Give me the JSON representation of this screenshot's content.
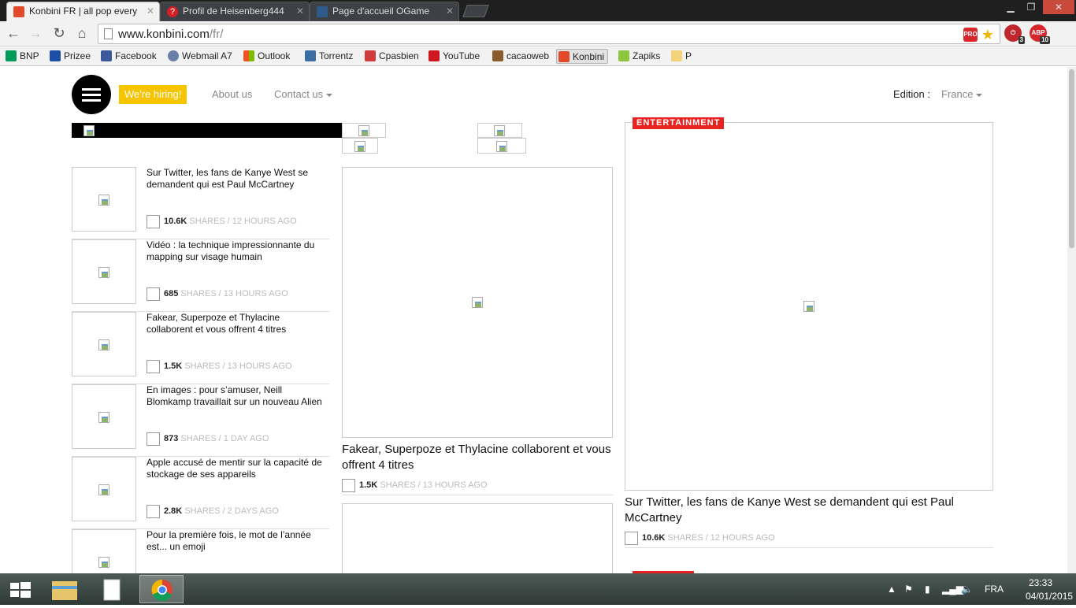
{
  "browser": {
    "tabs": [
      {
        "label": "Konbini FR | all pop every",
        "active": true
      },
      {
        "label": "Profil de Heisenberg444",
        "active": false
      },
      {
        "label": "Page d'accueil OGame",
        "active": false
      }
    ],
    "url_host": "www.konbini.com",
    "url_path": "/fr/",
    "omnibox_pro_badge": "PRO",
    "extensions": [
      {
        "name": "ublock-icon",
        "count": "3"
      },
      {
        "name": "abp-icon",
        "label": "ABP",
        "count": "10"
      }
    ],
    "bookmarks": [
      {
        "label": "BNP",
        "icon": "bnp-icon"
      },
      {
        "label": "Prizee",
        "icon": "prizee-icon"
      },
      {
        "label": "Facebook",
        "icon": "facebook-icon"
      },
      {
        "label": "Webmail A7",
        "icon": "webmail-icon"
      },
      {
        "label": "Outlook",
        "icon": "outlook-icon"
      },
      {
        "label": "Torrentz",
        "icon": "torrentz-icon"
      },
      {
        "label": "Cpasbien",
        "icon": "cpasbien-icon"
      },
      {
        "label": "YouTube",
        "icon": "youtube-icon"
      },
      {
        "label": "cacaoweb",
        "icon": "cacaoweb-icon"
      },
      {
        "label": "Konbini",
        "icon": "konbini-icon"
      },
      {
        "label": "Zapiks",
        "icon": "zapiks-icon"
      },
      {
        "label": "P",
        "icon": "folder-icon"
      }
    ]
  },
  "site": {
    "hiring": "We're hiring!",
    "about": "About us",
    "contact": "Contact us",
    "edition_label": "Edition :",
    "edition_value": "France",
    "shares_word": "SHARES",
    "sep": "/",
    "articles": [
      {
        "title": "Sur Twitter, les fans de Kanye West se demandent qui est Paul McCartney",
        "shares": "10.6K",
        "time": "12 HOURS AGO"
      },
      {
        "title": "Vidéo : la technique impressionnante du mapping sur visage humain",
        "shares": "685",
        "time": "13 HOURS AGO"
      },
      {
        "title": "Fakear, Superpoze et Thylacine collaborent et vous offrent 4 titres",
        "shares": "1.5K",
        "time": "13 HOURS AGO"
      },
      {
        "title": "En images : pour s’amuser, Neill Blomkamp travaillait sur un nouveau Alien",
        "shares": "873",
        "time": "1 DAY AGO"
      },
      {
        "title": "Apple accusé de mentir sur la capacité de stockage de ses appareils",
        "shares": "2.8K",
        "time": "2 DAYS AGO"
      },
      {
        "title": "Pour la première fois, le mot de l’année est... un emoji",
        "shares": "",
        "time": ""
      }
    ],
    "middle_feature": {
      "title": "Fakear, Superpoze et Thylacine collaborent et vous offrent 4 titres",
      "shares": "1.5K",
      "time": "13 HOURS AGO"
    },
    "right_feature": {
      "category": "ENTERTAINMENT",
      "title": "Sur Twitter, les fans de Kanye West se demandent qui est Paul McCartney",
      "shares": "10.6K",
      "time": "12 HOURS AGO"
    }
  },
  "taskbar": {
    "language": "FRA",
    "time": "23:33",
    "date": "04/01/2015"
  },
  "colors": {
    "hiring": "#f7c400",
    "entertainment": "#e8231f"
  }
}
